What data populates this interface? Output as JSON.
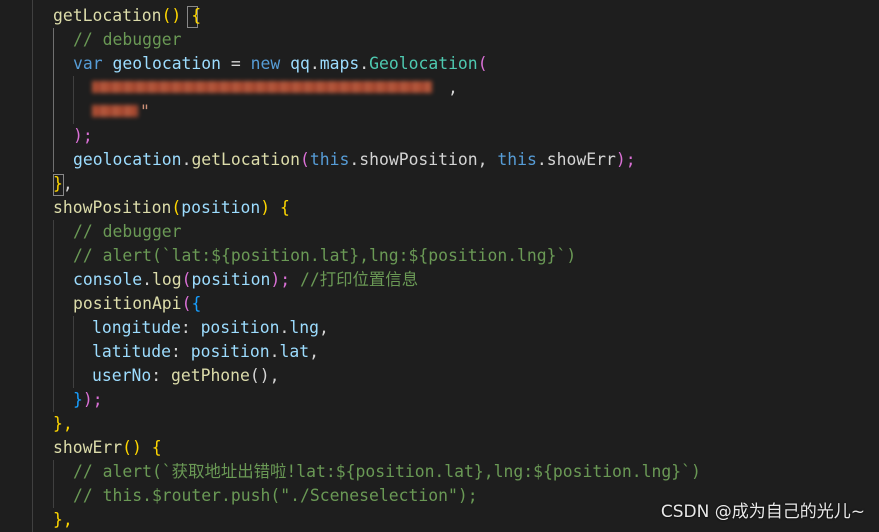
{
  "code": {
    "l1": {
      "name": "getLocation",
      "parens": "()",
      "brace": "{"
    },
    "l2": {
      "comment": "// debugger"
    },
    "l3": {
      "kw": "var",
      "var": "geolocation",
      "op": " = ",
      "new": "new",
      "ns1": "qq",
      "dot1": ".",
      "ns2": "maps",
      "dot2": ".",
      "cls": "Geolocation",
      "paren": "("
    },
    "l4": {
      "comma": ","
    },
    "l5": {
      "str_end": "\""
    },
    "l6": {
      "text": ");"
    },
    "l7": {
      "obj": "geolocation",
      "dot": ".",
      "method": "getLocation",
      "open": "(",
      "this1": "this",
      "arg1": ".showPosition",
      "sep": ", ",
      "this2": "this",
      "arg2": ".showErr",
      "close": ");"
    },
    "l8": {
      "brace": "}",
      "comma": ","
    },
    "l9": {
      "name": "showPosition",
      "open": "(",
      "param": "position",
      "close": ")",
      "brace": " {"
    },
    "l10": {
      "comment": "// debugger"
    },
    "l11": {
      "comment": "// alert(`lat:${position.lat},lng:${position.lng}`)"
    },
    "l12": {
      "obj": "console",
      "dot": ".",
      "method": "log",
      "open": "(",
      "arg": "position",
      "close": ");",
      "comment": " //打印位置信息"
    },
    "l13": {
      "name": "positionApi",
      "open": "(",
      "brace": "{"
    },
    "l14": {
      "key": "longitude",
      "colon": ": ",
      "obj": "position",
      "dot": ".",
      "prop": "lng",
      "comma": ","
    },
    "l15": {
      "key": "latitude",
      "colon": ": ",
      "obj": "position",
      "dot": ".",
      "prop": "lat",
      "comma": ","
    },
    "l16": {
      "key": "userNo",
      "colon": ": ",
      "fn": "getPhone",
      "call": "()",
      "comma": ","
    },
    "l17": {
      "brace": "}",
      "close": ");"
    },
    "l18": {
      "text": "},"
    },
    "l19": {
      "name": "showErr",
      "parens": "()",
      "brace": " {"
    },
    "l20": {
      "comment": "// alert(`获取地址出错啦!lat:${position.lat},lng:${position.lng}`)"
    },
    "l21": {
      "comment": "// this.$router.push(\"./Sceneselection\");"
    },
    "l22": {
      "text": "},"
    }
  },
  "watermark": "CSDN @成为自己的光儿~",
  "colors": {
    "background": "#1e1e1e",
    "function": "#dcdcaa",
    "keyword": "#569cd6",
    "variable": "#9cdcfe",
    "class": "#4ec9b0",
    "string": "#ce9178",
    "comment": "#6a9955"
  }
}
